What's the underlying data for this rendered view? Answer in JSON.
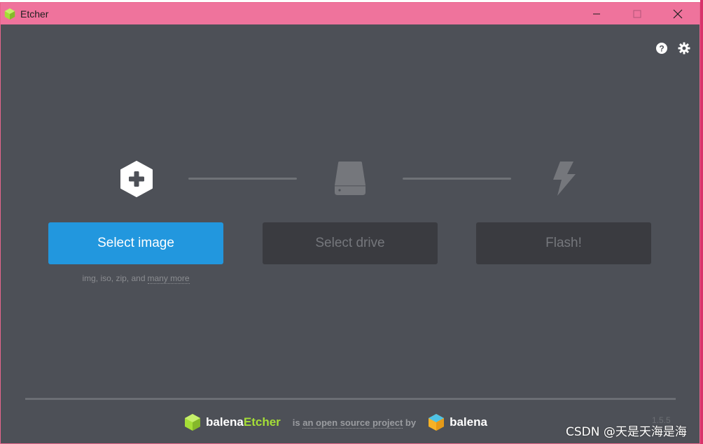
{
  "window": {
    "title": "Etcher",
    "controls": {
      "minimize": "minimize-icon",
      "maximize": "maximize-icon",
      "close": "close-icon"
    }
  },
  "header_icons": [
    "help-icon",
    "settings-icon"
  ],
  "steps": {
    "image": {
      "icon": "plus-hexagon-icon",
      "button_label": "Select image",
      "hint_prefix": "img, iso, zip, and",
      "hint_link": "many more"
    },
    "drive": {
      "icon": "drive-icon",
      "button_label": "Select drive"
    },
    "flash": {
      "icon": "lightning-icon",
      "button_label": "Flash!"
    }
  },
  "footer": {
    "brand_part1": "balena",
    "brand_part2": "Etcher",
    "tagline_prefix": "is",
    "tagline_link": "an open source project",
    "tagline_suffix": "by",
    "company": "balena",
    "version": "1.5.5"
  },
  "watermark": "CSDN @天是天海是海",
  "colors": {
    "titlebar": "#ef739c",
    "background": "#4d5057",
    "primary_button": "#2297de",
    "disabled_button": "#3a3b40",
    "etcher_green": "#a5de37"
  }
}
